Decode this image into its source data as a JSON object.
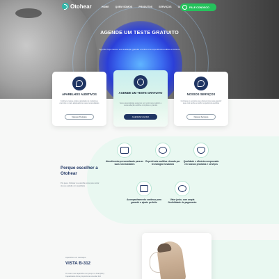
{
  "nav": {
    "logo_text": "Otohear",
    "links": [
      "HOME",
      "QUEM SOMOS",
      "PRODUTOS",
      "SERVIÇOS",
      "CONTATO"
    ],
    "cta": "FALE CONOSCO"
  },
  "hero": {
    "title": "AGENDE UM TESTE GRATUITO",
    "subtitle": "Agende hoje mesmo sua avaliação gratuita e tenha uma experiência auditiva excelente"
  },
  "cards": [
    {
      "title": "APARELHOS AUDITIVOS",
      "text": "Conheça nossa ampla variedade de modelos e encontre o mais adequado às suas necessidades",
      "button": "Nossos Produtos",
      "icon": "ear-icon"
    },
    {
      "title": "AGENDE UM TESTE GRATUITO",
      "text": "Seus especialistas esperam por você para realizar a sua avaliação auditiva completa e gratuita",
      "button": "AGENDAR AGORA",
      "icon": "check-badge-icon"
    },
    {
      "title": "NOSSOS SERVIÇOS",
      "text": "Conheça os serviços que oferecemos para garantir que você tenha a melhor experiência auditiva",
      "button": "Nossos Serviços",
      "icon": "service-icon"
    }
  ],
  "why": {
    "title": "Porque escolher a Otohear",
    "text": "Por que a Otohear é a escolha certa para cuidar da sua audição com qualidade",
    "features": [
      {
        "label": "Atendimento personalizado para as suas necessidades",
        "icon": "people-icon"
      },
      {
        "label": "Experiência auditiva elevada por tecnologia inovadora",
        "icon": "chip-icon"
      },
      {
        "label": "Qualidade e eficácia comprovada em nossos produtos e serviços",
        "icon": "shield-icon"
      },
      {
        "label": "Acompanhamento contínuo para garantir o ajuste perfeito",
        "icon": "support-icon"
      },
      {
        "label": "Valor justo, com ampla flexibilidade de pagamento",
        "icon": "handshake-icon"
      }
    ]
  },
  "product": {
    "kicker": "Aparelhos em destaque",
    "name": "VISTA B-312",
    "description": "O nosso novo aparelho com preço no final (RIC). Capacidade ótima proporciona conexão 312"
  },
  "colors": {
    "navy": "#1f3563",
    "mint": "#e9f8f1",
    "whatsapp": "#25c25c",
    "glow": "#3c6cf0"
  }
}
